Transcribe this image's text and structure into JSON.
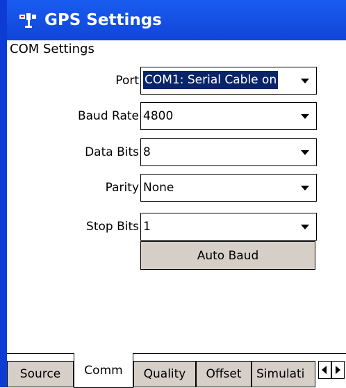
{
  "window": {
    "title": "GPS Settings",
    "icon": "satellite-icon"
  },
  "section": {
    "label": "COM Settings"
  },
  "fields": [
    {
      "label": "Port",
      "value": "COM1: Serial Cable on"
    },
    {
      "label": "Baud Rate",
      "value": "4800"
    },
    {
      "label": "Data Bits",
      "value": "8"
    },
    {
      "label": "Parity",
      "value": "None"
    },
    {
      "label": "Stop Bits",
      "value": "1"
    }
  ],
  "buttons": {
    "auto_baud": "Auto Baud"
  },
  "tabs": [
    {
      "label": "Source"
    },
    {
      "label": "Comm"
    },
    {
      "label": "Quality"
    },
    {
      "label": "Offset"
    },
    {
      "label": "Simulati"
    }
  ],
  "colors": {
    "title_bar": "#1a5cf0",
    "selection": "#0a246a",
    "button_face": "#d6cfc8"
  }
}
